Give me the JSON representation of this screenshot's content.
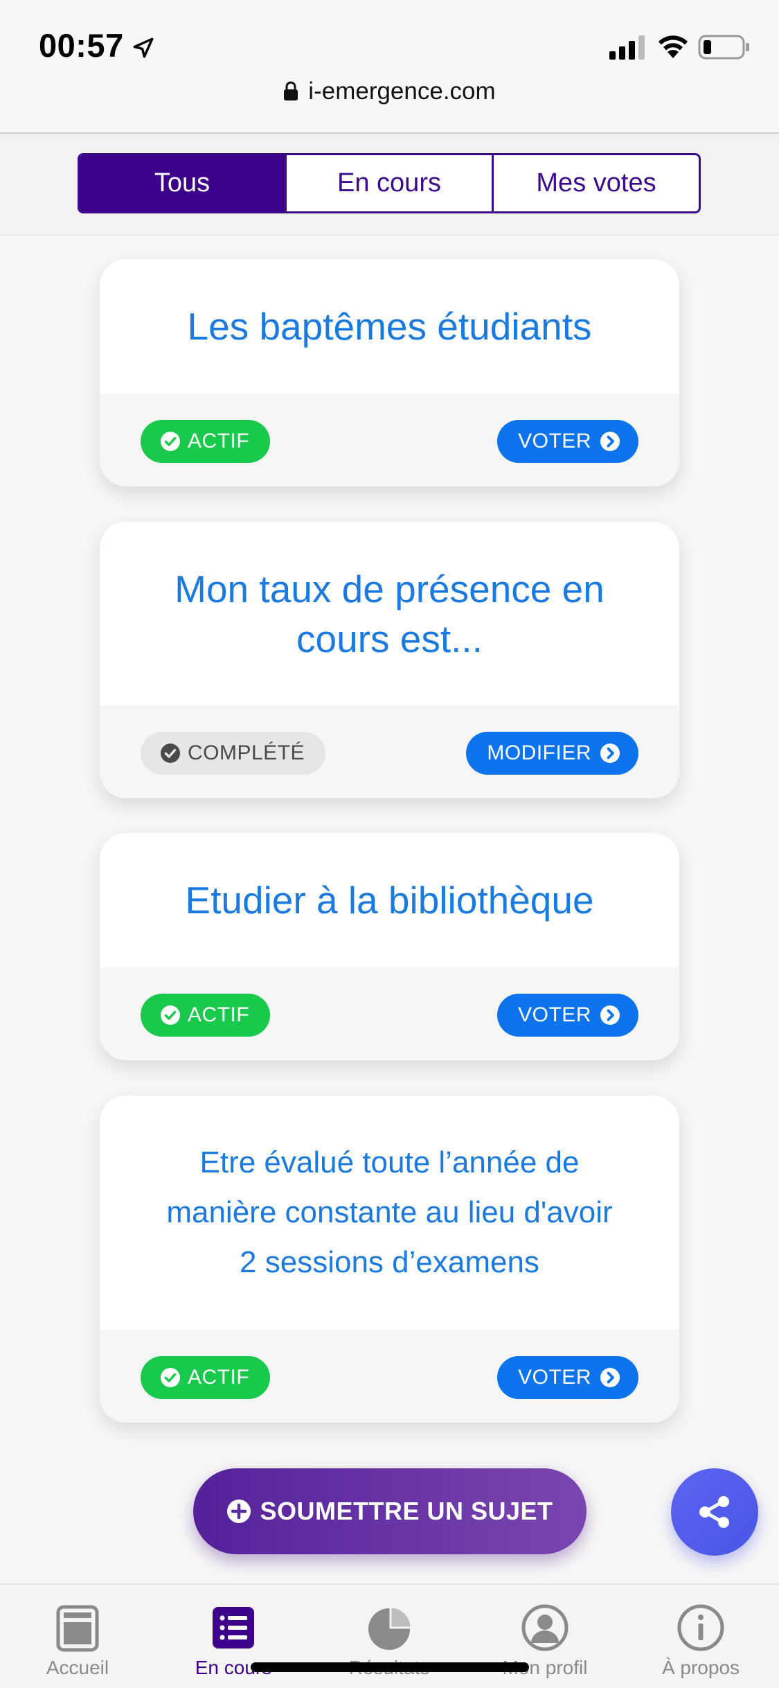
{
  "status": {
    "time": "00:57",
    "url": "i-emergence.com"
  },
  "filters": {
    "tabs": [
      {
        "label": "Tous",
        "active": true
      },
      {
        "label": "En cours",
        "active": false
      },
      {
        "label": "Mes votes",
        "active": false
      }
    ]
  },
  "cards": [
    {
      "title": "Les baptêmes étudiants",
      "badge": "ACTIF",
      "action": "VOTER"
    },
    {
      "title": "Mon taux de présence en cours est...",
      "badge": "COMPLÉTÉ",
      "action": "MODIFIER"
    },
    {
      "title": "Etudier à la bibliothèque",
      "badge": "ACTIF",
      "action": "VOTER"
    },
    {
      "title": "Etre évalué toute l’année de manière constante au lieu d'avoir 2 sessions d’examens",
      "badge": "ACTIF",
      "action": "VOTER"
    }
  ],
  "submit": {
    "label": "SOUMETTRE UN SUJET"
  },
  "tabbar": {
    "items": [
      {
        "label": "Accueil",
        "icon": "home-icon"
      },
      {
        "label": "En cours",
        "icon": "list-icon",
        "current": true
      },
      {
        "label": "Résultats",
        "icon": "pie-chart-icon"
      },
      {
        "label": "Mon profil",
        "icon": "profile-icon"
      },
      {
        "label": "À propos",
        "icon": "info-icon"
      }
    ]
  },
  "colors": {
    "primary_purple": "#3c0289",
    "title_blue": "#1b7ae0",
    "badge_green": "#19c94c",
    "button_blue": "#0d74ee",
    "share_blue": "#5c63f0"
  }
}
